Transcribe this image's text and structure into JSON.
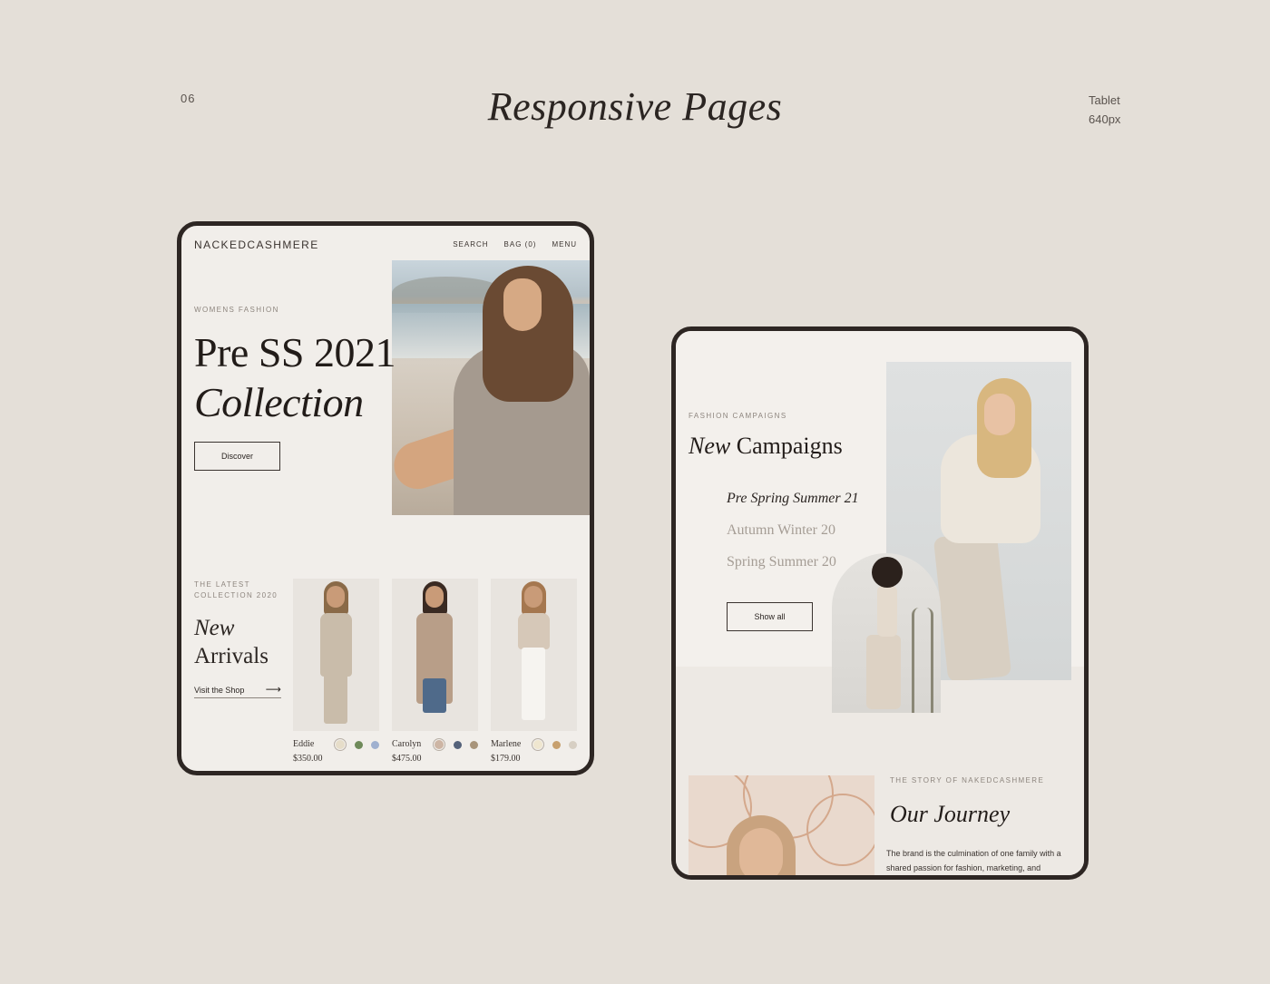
{
  "header": {
    "page_number": "06",
    "title": "Responsive Pages",
    "device": "Tablet",
    "width_label": "640px"
  },
  "tablet_home": {
    "brand": "NACKEDCASHMERE",
    "nav": [
      "SEARCH",
      "BAG (0)",
      "MENU"
    ],
    "hero": {
      "eyebrow": "WOMENS FASHION",
      "title_line1": "Pre SS 2021",
      "title_line2": "Collection",
      "button": "Discover"
    },
    "new_arrivals": {
      "eyebrow_line1": "THE LATEST",
      "eyebrow_line2": "COLLECTION 2020",
      "title_line1": "New",
      "title_line2": "Arrivals",
      "link": "Visit the Shop",
      "products": [
        {
          "name": "Eddie",
          "price": "$350.00",
          "swatches": [
            "#e6ddc9",
            "#6f8a5a",
            "#9fb0cf"
          ]
        },
        {
          "name": "Carolyn",
          "price": "$475.00",
          "swatches": [
            "#cdb5a4",
            "#55627a",
            "#a8947a"
          ]
        },
        {
          "name": "Marlene",
          "price": "$179.00",
          "swatches": [
            "#efe6cf",
            "#c7a06e",
            "#d7cfc3"
          ]
        }
      ]
    }
  },
  "tablet_campaigns": {
    "eyebrow": "FASHION CAMPAIGNS",
    "title_italic": "New",
    "title_rest": "Campaigns",
    "campaigns": [
      {
        "label": "Pre Spring Summer 21",
        "active": true
      },
      {
        "label": "Autumn Winter 20",
        "active": false
      },
      {
        "label": "Spring Summer 20",
        "active": false
      }
    ],
    "button": "Show all",
    "story": {
      "eyebrow": "THE STORY OF NAKEDCASHMERE",
      "title": "Our Journey",
      "text": "The brand is the culmination of one family with a shared passion for fashion, marketing, and"
    }
  },
  "colors": {
    "background": "#e4dfd8",
    "screen": "#f1eeea",
    "frame": "#2d2623",
    "muted_text": "#8d857e"
  }
}
